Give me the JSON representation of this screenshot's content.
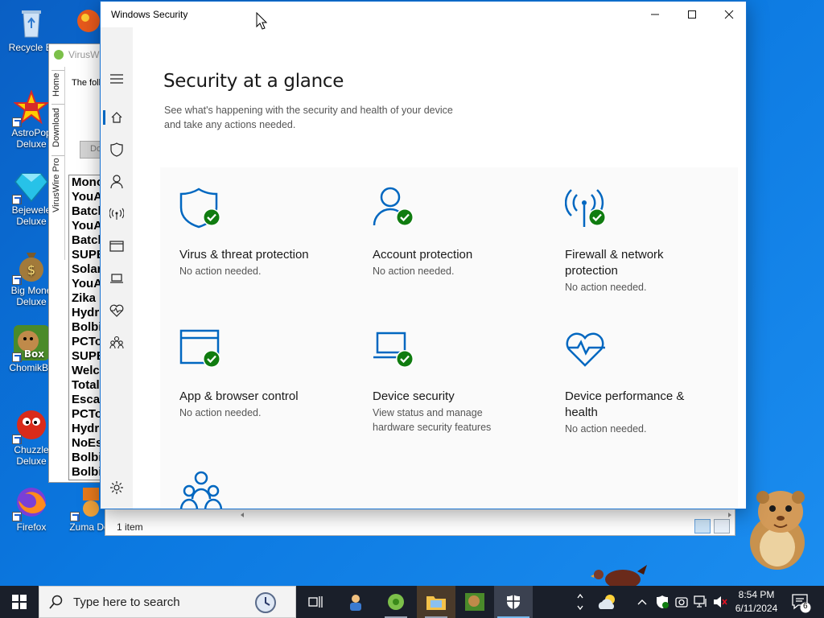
{
  "desktop": {
    "icons": [
      {
        "label": "Recycle Bi",
        "icon": "recycle-bin-icon"
      },
      {
        "label": "AstroPop Deluxe",
        "icon": "astropop-icon"
      },
      {
        "label": "Bejewele Deluxe",
        "icon": "bejeweled-icon"
      },
      {
        "label": "Big Mone Deluxe",
        "icon": "big-money-icon"
      },
      {
        "label": "ChomikBo",
        "icon": "chomikbox-icon"
      },
      {
        "label": "Chuzzle Deluxe",
        "icon": "chuzzle-icon"
      },
      {
        "label": "Firefox",
        "icon": "firefox-icon"
      },
      {
        "label": "Zuma De",
        "icon": "zuma-icon"
      }
    ]
  },
  "viruswire": {
    "title": "VirusW",
    "tabs": [
      "Home",
      "Download",
      "VirusWire Pro"
    ],
    "text": "The foll",
    "button": "Do",
    "list": [
      "Mono",
      "YouA",
      "Batch",
      "YouA",
      "Batch",
      "SUPE",
      "Solar",
      "YouA",
      "Zika",
      "Hydr",
      "Bolbi",
      "PCTo",
      "SUPE",
      "Welc",
      "Total",
      "Escap",
      "PCTo",
      "Hydr",
      "NoEs",
      "Bolbi",
      "Bolbi"
    ]
  },
  "explorer": {
    "status": "1 item"
  },
  "security": {
    "window_title": "Windows Security",
    "page_title": "Security at a glance",
    "page_subtitle_line1": "See what's happening with the security and health of your device",
    "page_subtitle_line2": "and take any actions needed.",
    "tiles": [
      {
        "title": "Virus & threat protection",
        "status": "No action needed.",
        "icon": "shield-check-icon"
      },
      {
        "title": "Account protection",
        "status": "No action needed.",
        "icon": "person-check-icon"
      },
      {
        "title_line1": "Firewall & network",
        "title_line2": "protection",
        "status": "No action needed.",
        "icon": "antenna-check-icon"
      },
      {
        "title": "App & browser control",
        "status": "No action needed.",
        "icon": "browser-check-icon"
      },
      {
        "title": "Device security",
        "status_line1": "View status and manage",
        "status_line2": "hardware security features",
        "icon": "laptop-check-icon"
      },
      {
        "title_line1": "Device performance &",
        "title_line2": "health",
        "status": "No action needed.",
        "icon": "heart-pulse-icon"
      },
      {
        "icon": "family-icon"
      }
    ],
    "nav": [
      "back-arrow-icon",
      "hamburger-menu-icon",
      "home-icon",
      "shield-icon",
      "person-icon",
      "wifi-antenna-icon",
      "app-browser-icon",
      "laptop-icon",
      "heart-icon",
      "family-icon",
      "settings-gear-icon"
    ],
    "accent": "#0067c0",
    "ok_green": "#107c10"
  },
  "taskbar": {
    "search_placeholder": "Type here to search",
    "time": "8:54 PM",
    "date": "6/11/2024",
    "notifications": "6"
  }
}
